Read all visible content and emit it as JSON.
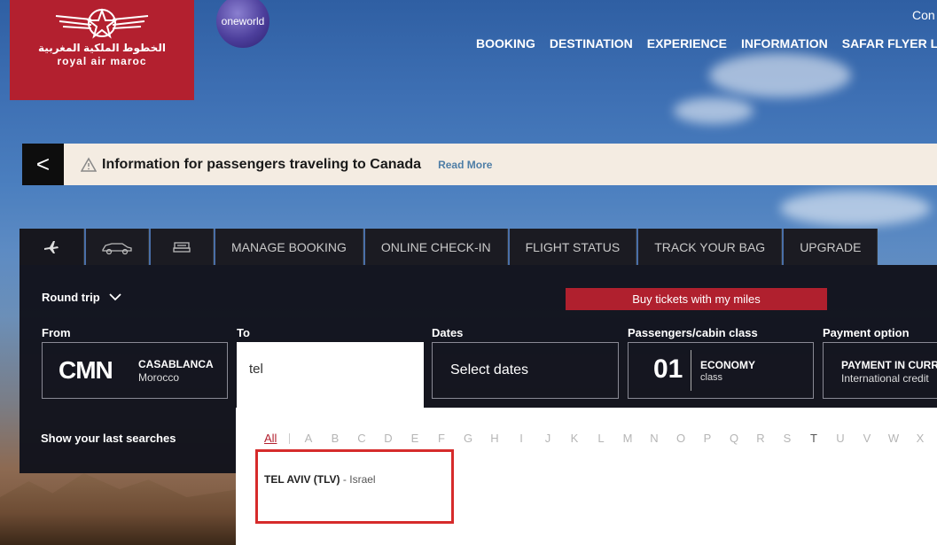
{
  "brand": {
    "arabic_name": "الخطوط الملكية المغربية",
    "name": "royal air maroc",
    "alliance": "oneworld",
    "colors": {
      "red": "#b3202f",
      "panel": "#12131c",
      "link": "#4f7ea6"
    }
  },
  "header": {
    "top_right": "Con",
    "nav": [
      "BOOKING",
      "DESTINATION",
      "EXPERIENCE",
      "INFORMATION",
      "SAFAR FLYER LOYA"
    ]
  },
  "banner": {
    "back_glyph": "<",
    "text": "Information for passengers traveling to Canada",
    "link": "Read More"
  },
  "tabs": {
    "icons": [
      "plane-icon",
      "car-icon",
      "hotel-bed-icon"
    ],
    "labels": [
      "MANAGE BOOKING",
      "ONLINE CHECK-IN",
      "FLIGHT STATUS",
      "TRACK YOUR BAG",
      "UPGRADE"
    ]
  },
  "search": {
    "trip_type": "Round trip",
    "miles_button": "Buy tickets with my miles",
    "from": {
      "label": "From",
      "code": "CMN",
      "city": "CASABLANCA",
      "country": "Morocco"
    },
    "to": {
      "label": "To",
      "value": "tel"
    },
    "dates": {
      "label": "Dates",
      "value": "Select dates"
    },
    "passengers": {
      "label": "Passengers/cabin class",
      "count": "01",
      "class": "ECONOMY",
      "class_sub": "class"
    },
    "payment": {
      "label": "Payment option",
      "title": "PAYMENT IN CURR",
      "subtitle": "International credit"
    },
    "last_searches": "Show your last searches"
  },
  "dropdown": {
    "alphabet": [
      "All",
      "A",
      "B",
      "C",
      "D",
      "E",
      "F",
      "G",
      "H",
      "I",
      "J",
      "K",
      "L",
      "M",
      "N",
      "O",
      "P",
      "Q",
      "R",
      "S",
      "T",
      "U",
      "V",
      "W",
      "X"
    ],
    "results": [
      {
        "city": "TEL AVIV (TLV)",
        "country": "Israel"
      }
    ]
  }
}
